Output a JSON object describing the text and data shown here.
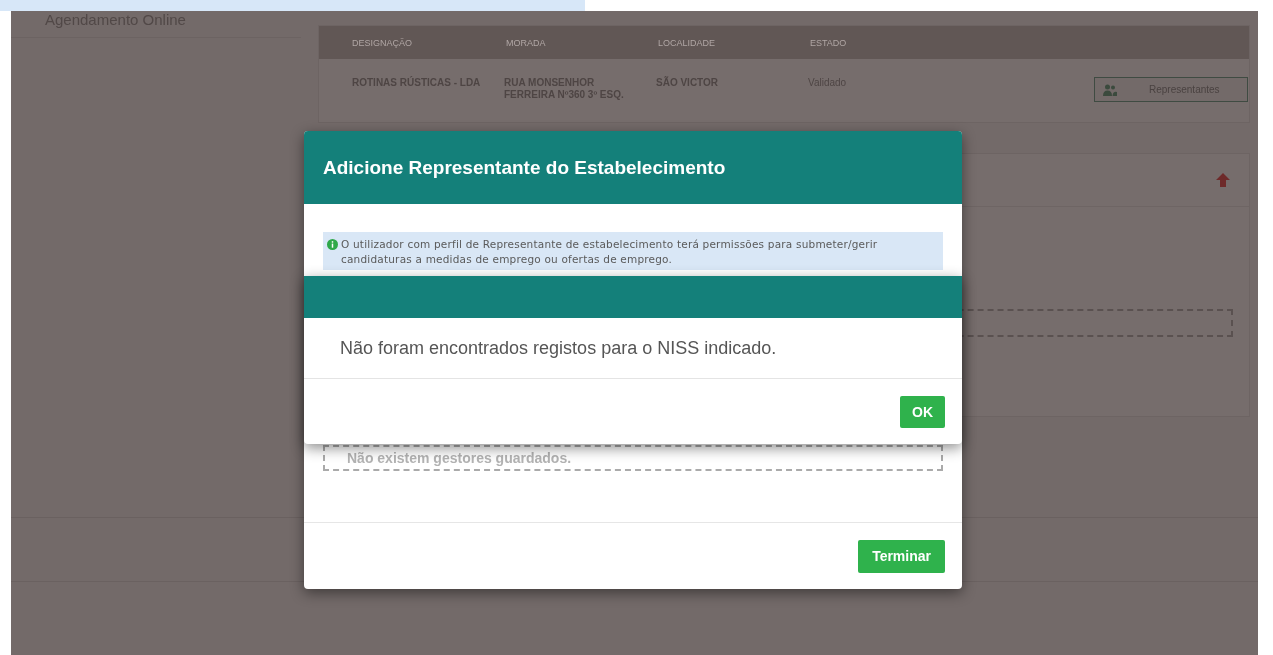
{
  "sidebar": {
    "items": [
      {
        "label": "Agendamento Online"
      }
    ]
  },
  "establishments": {
    "columns": [
      "DESIGNAÇÃO",
      "MORADA",
      "LOCALIDADE",
      "ESTADO"
    ],
    "rows": [
      {
        "cells": [
          "ROTINAS RÚSTICAS - LDA",
          "RUA MONSENHOR FERREIRA Nº360 3º ESQ.",
          "SÃO VICTOR",
          "Validado"
        ],
        "action": "Representantes"
      }
    ]
  },
  "dialog": {
    "title": "Adicione Representante do Estabelecimento",
    "info": "O utilizador com perfil de Representante de estabelecimento terá permissões para submeter/gerir candidaturas a medidas de emprego ou ofertas de emprego.",
    "empty_message": "Não existem gestores guardados.",
    "button": "Terminar"
  },
  "alert": {
    "message": "Não foram encontrados registos para o NISS indicado.",
    "button": "OK"
  }
}
